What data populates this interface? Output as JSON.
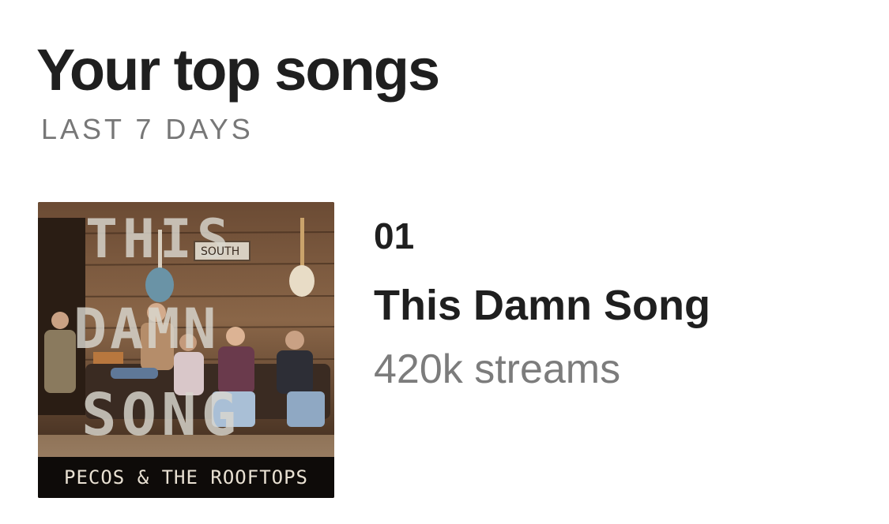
{
  "header": {
    "title": "Your top songs",
    "period": "LAST 7 DAYS"
  },
  "tracks": [
    {
      "rank": "01",
      "title": "This Damn Song",
      "streams": "420k streams",
      "cover": {
        "band_text": "PECOS & THE ROOFTOPS",
        "painted_title": "THIS DAMN SONG",
        "sign_text": "SOUTH"
      }
    }
  ]
}
